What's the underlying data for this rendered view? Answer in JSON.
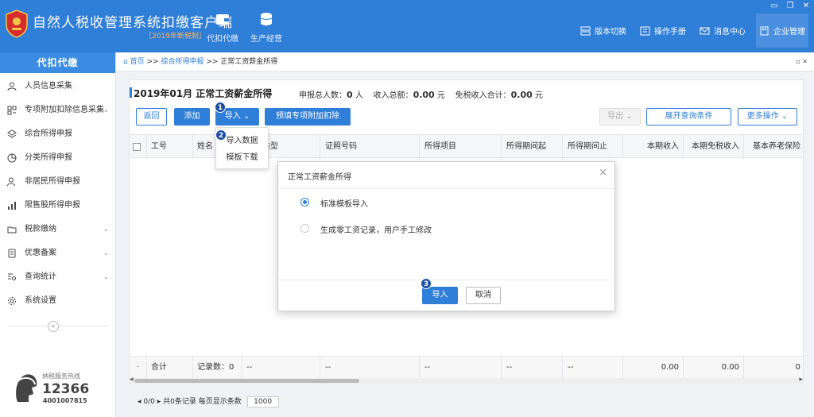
{
  "app": {
    "title": "自然人税收管理系统扣缴客户端",
    "subtitle": "［2019年新税制］"
  },
  "topnav": [
    {
      "label": "代扣代缴"
    },
    {
      "label": "生产经营"
    }
  ],
  "tools": [
    {
      "label": "版本切换"
    },
    {
      "label": "操作手册"
    },
    {
      "label": "消息中心"
    },
    {
      "label": "企业管理"
    }
  ],
  "window": {
    "minimize": "▭",
    "restore": "❐",
    "close": "✕"
  },
  "sidebar": {
    "header": "代扣代缴",
    "items": [
      {
        "label": "人员信息采集"
      },
      {
        "label": "专项附加扣除信息采集"
      },
      {
        "label": "综合所得申报"
      },
      {
        "label": "分类所得申报"
      },
      {
        "label": "非居民所得申报"
      },
      {
        "label": "限售股所得申报"
      },
      {
        "label": "税款缴纳"
      },
      {
        "label": "优惠备案"
      },
      {
        "label": "查询统计"
      },
      {
        "label": "系统设置"
      }
    ],
    "collapse": "«",
    "hotline": {
      "label": "纳税服务热线",
      "number": "12366",
      "tel": "4001007815"
    }
  },
  "breadcrumb": {
    "home": "首页",
    "sep1": " >> ",
    "level1": "综合所得申报",
    "sep2": " >> ",
    "current": "正常工资薪金所得",
    "controls": "▫ ✕"
  },
  "main": {
    "title": "2019年01月  正常工资薪金所得",
    "stats": {
      "people_label": "申报总人数：",
      "people_value": "0",
      "people_unit": "人",
      "income_label": "收入总额：",
      "income_value": "0.00",
      "income_unit": "元",
      "free_label": "免税收入合计：",
      "free_value": "0.00",
      "free_unit": "元"
    },
    "buttons": {
      "back": "返回",
      "add": "添加",
      "import": "导入  ⌄",
      "prefill": "预填专项附加扣除",
      "export": "导出  ⌄",
      "expand": "展开查询条件",
      "more": "更多操作  ⌄"
    },
    "columns": [
      "工号",
      "姓名",
      "类型",
      "证照号码",
      "所得项目",
      "所得期间起",
      "所得期间止",
      "本期收入",
      "本期免税收入",
      "基本养老保险"
    ],
    "footer": {
      "dot": "·",
      "total_label": "合计",
      "records": "记录数：0",
      "dashes": "--",
      "income_total": "0.00",
      "free_total": "0.00",
      "last": "0"
    },
    "pager": {
      "nav": "◂ 0/0 ▸",
      "records": "共0条记录",
      "per_page_label": "每页显示条数",
      "per_page_value": "1000"
    }
  },
  "dropdown": {
    "items": [
      {
        "label": "导入数据"
      },
      {
        "label": "模板下载"
      }
    ]
  },
  "modal": {
    "title": "正常工资薪金所得",
    "close": "×",
    "options": [
      {
        "label": "标准模板导入",
        "selected": true
      },
      {
        "label": "生成零工资记录，用户手工修改",
        "selected": false
      }
    ],
    "confirm": "导入",
    "cancel": "取消"
  },
  "badges": [
    "1",
    "2",
    "3"
  ]
}
